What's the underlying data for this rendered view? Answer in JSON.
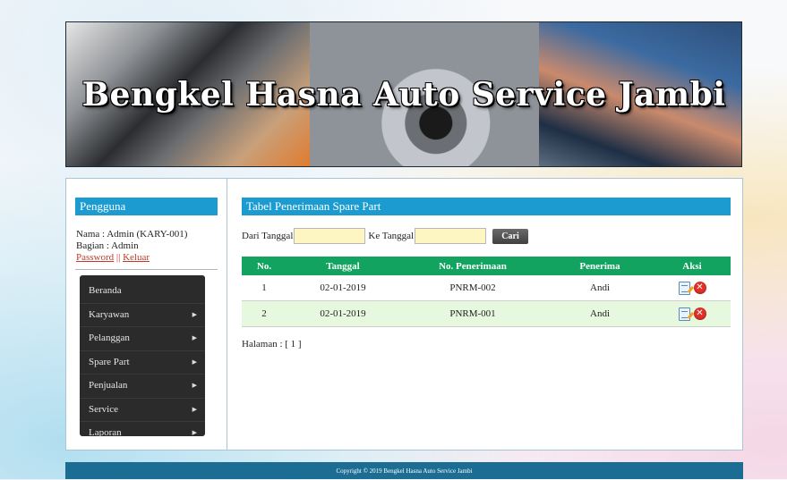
{
  "banner": {
    "title": "Bengkel Hasna Auto Service Jambi"
  },
  "sidebar": {
    "title": "Pengguna",
    "user_name": "Nama : Admin (KARY-001)",
    "user_role": "Bagian : Admin",
    "password_link": "Password",
    "separator": "||",
    "logout_link": "Keluar",
    "menu": [
      {
        "label": "Beranda",
        "has_submenu": false
      },
      {
        "label": "Karyawan",
        "has_submenu": true
      },
      {
        "label": "Pelanggan",
        "has_submenu": true
      },
      {
        "label": "Spare Part",
        "has_submenu": true
      },
      {
        "label": "Penjualan",
        "has_submenu": true
      },
      {
        "label": "Service",
        "has_submenu": true
      },
      {
        "label": "Laporan",
        "has_submenu": true
      }
    ],
    "submenu_arrow": "▶"
  },
  "main": {
    "title": "Tabel Penerimaan Spare Part",
    "filter": {
      "from_label": "Dari Tanggal",
      "from_value": "",
      "to_label": "Ke Tanggal",
      "to_value": "",
      "search_button": "Cari"
    },
    "table": {
      "headers": [
        "No.",
        "Tanggal",
        "No. Penerimaan",
        "Penerima",
        "Aksi"
      ],
      "rows": [
        {
          "no": "1",
          "tanggal": "02-01-2019",
          "no_penerimaan": "PNRM-002",
          "penerima": "Andi"
        },
        {
          "no": "2",
          "tanggal": "02-01-2019",
          "no_penerimaan": "PNRM-001",
          "penerima": "Andi"
        }
      ]
    },
    "pagination": "Halaman : [ 1 ]"
  },
  "footer": {
    "text": "Copyright © 2019 Bengkel Hasna Auto Service Jambi"
  },
  "icons": {
    "edit": "edit-icon",
    "delete": "delete-icon",
    "delete_glyph": "✕"
  },
  "colors": {
    "accent_blue": "#1b9bd0",
    "table_header_green": "#11a35f",
    "footer": "#1b6d93"
  }
}
